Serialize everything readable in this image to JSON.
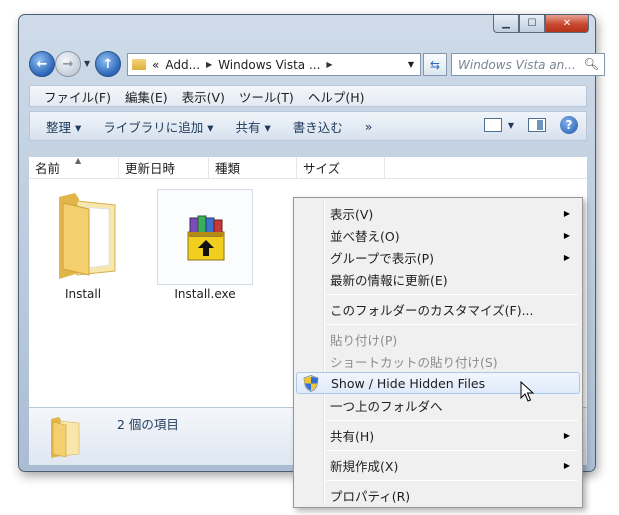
{
  "window": {
    "minimize": "▁",
    "maximize": "☐",
    "close": "✕"
  },
  "address": {
    "crumb_prefix": "«",
    "crumb_1": "Add...",
    "crumb_2": "Windows Vista ...",
    "search_placeholder": "Windows Vista an..."
  },
  "menubar": [
    "ファイル(F)",
    "編集(E)",
    "表示(V)",
    "ツール(T)",
    "ヘルプ(H)"
  ],
  "commands": [
    "整理 ▾",
    "ライブラリに追加 ▾",
    "共有 ▾",
    "書き込む",
    "»"
  ],
  "columns": [
    "名前",
    "更新日時",
    "種類",
    "サイズ"
  ],
  "files": [
    {
      "name": "Install",
      "icon": "folder-icon"
    },
    {
      "name": "Install.exe",
      "icon": "winrar-archive-icon"
    }
  ],
  "details": {
    "count_text": "2 個の項目"
  },
  "context_menu": [
    {
      "label": "表示(V)",
      "submenu": true,
      "enabled": true
    },
    {
      "label": "並べ替え(O)",
      "submenu": true,
      "enabled": true
    },
    {
      "label": "グループで表示(P)",
      "submenu": true,
      "enabled": true
    },
    {
      "label": "最新の情報に更新(E)",
      "submenu": false,
      "enabled": true
    },
    {
      "label": "このフォルダーのカスタマイズ(F)...",
      "submenu": false,
      "enabled": true
    },
    {
      "label": "貼り付け(P)",
      "submenu": false,
      "enabled": false
    },
    {
      "label": "ショートカットの貼り付け(S)",
      "submenu": false,
      "enabled": false
    },
    {
      "label": "Show / Hide Hidden Files",
      "submenu": false,
      "enabled": true,
      "icon": "uac-shield-icon"
    },
    {
      "label": "一つ上のフォルダへ",
      "submenu": false,
      "enabled": true
    },
    {
      "label": "共有(H)",
      "submenu": true,
      "enabled": true
    },
    {
      "label": "新規作成(X)",
      "submenu": true,
      "enabled": true
    },
    {
      "label": "プロパティ(R)",
      "submenu": false,
      "enabled": true
    }
  ]
}
